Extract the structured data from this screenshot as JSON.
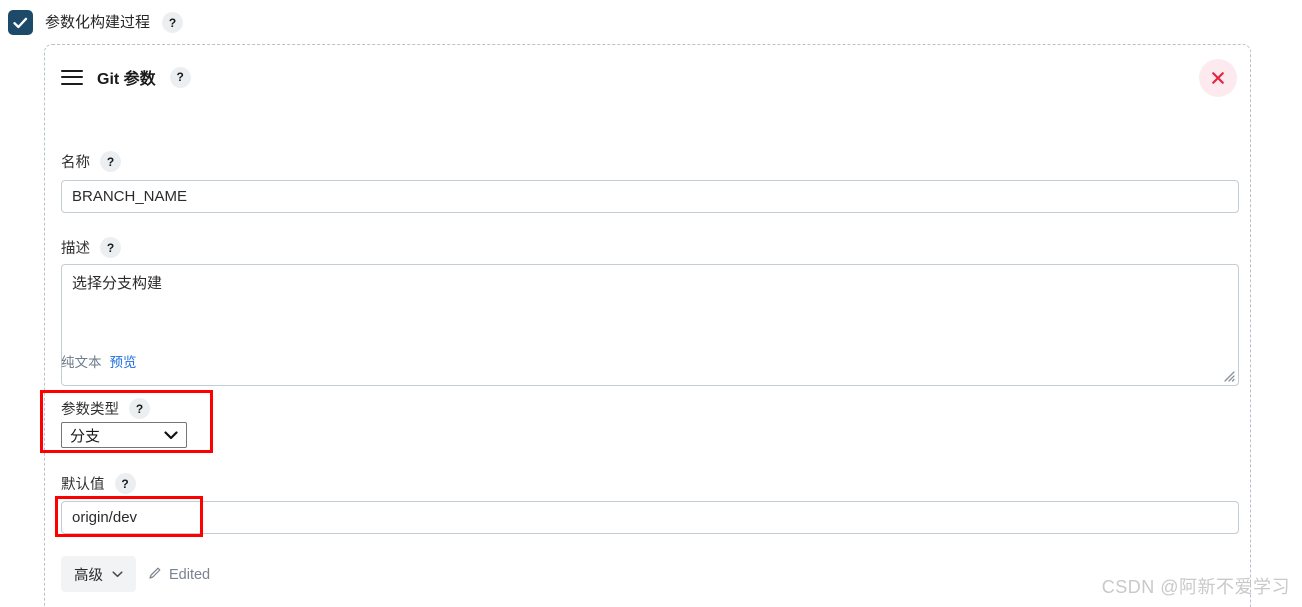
{
  "section": {
    "title": "参数化构建过程",
    "checkbox_checked": true,
    "help_label": "?",
    "checkbox_color": "#1d4a68"
  },
  "card": {
    "title": "Git 参数",
    "help_label": "?",
    "drag_handle_icon": "hamburger-icon",
    "close_icon": "close-icon",
    "close_icon_color": "#e8203f",
    "close_bg_color": "#fdeaee"
  },
  "fields": {
    "name": {
      "label": "名称",
      "help_label": "?",
      "value": "BRANCH_NAME",
      "placeholder": ""
    },
    "description": {
      "label": "描述",
      "help_label": "?",
      "value": "选择分支构建",
      "placeholder": "",
      "mode_plain": "纯文本",
      "mode_preview": "预览"
    },
    "param_type": {
      "label": "参数类型",
      "help_label": "?",
      "value": "分支",
      "options": [
        "分支"
      ],
      "chevron_icon": "chevron-down-icon"
    },
    "default_value": {
      "label": "默认值",
      "help_label": "?",
      "value": "origin/dev",
      "placeholder": ""
    }
  },
  "footer": {
    "advanced_label": "高级",
    "advanced_chevron_icon": "chevron-down-icon",
    "edited_label": "Edited",
    "edited_icon": "pencil-icon"
  },
  "annotations": {
    "highlight_color": "#ff0000",
    "boxes": [
      {
        "name": "param-type-highlight"
      },
      {
        "name": "default-value-highlight"
      }
    ]
  },
  "watermark": {
    "text": "CSDN @阿新不爱学习"
  }
}
